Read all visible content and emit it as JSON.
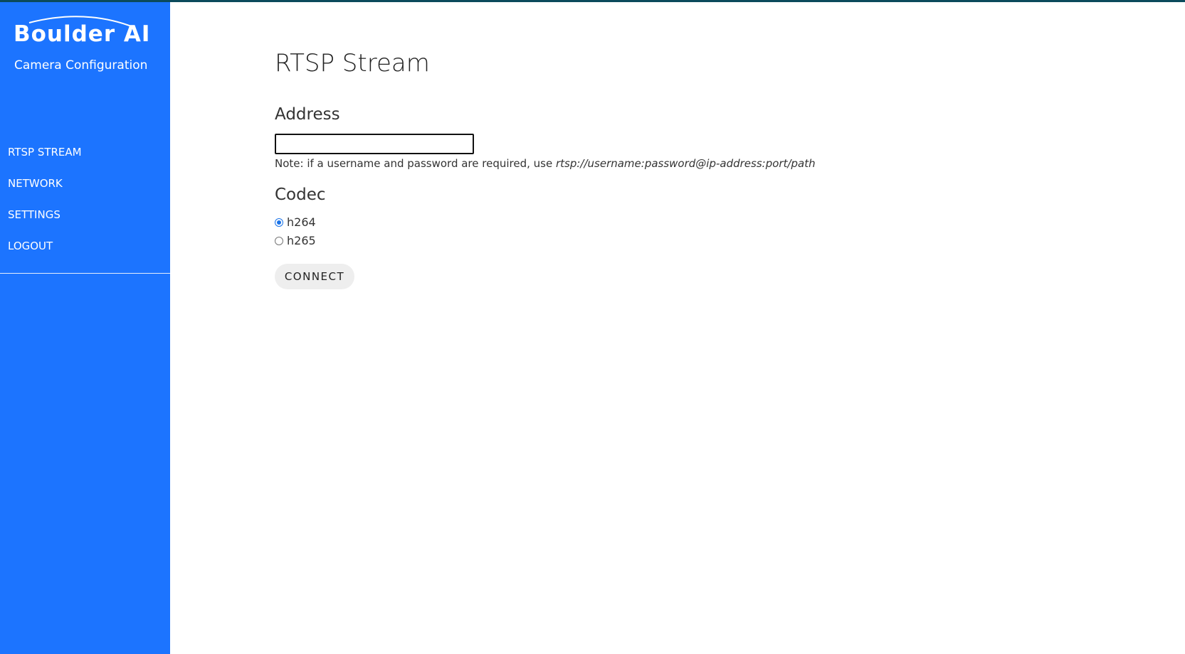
{
  "brand": {
    "logo_text": "Boulder AI",
    "subtitle": "Camera Configuration"
  },
  "nav": {
    "items": [
      {
        "label": "RTSP STREAM"
      },
      {
        "label": "NETWORK"
      },
      {
        "label": "SETTINGS"
      },
      {
        "label": "LOGOUT"
      }
    ]
  },
  "page": {
    "title": "RTSP Stream"
  },
  "address": {
    "label": "Address",
    "value": "",
    "placeholder": "",
    "note_prefix": "Note: if a username and password are required, use ",
    "note_example": "rtsp://username:password@ip-address:port/path"
  },
  "codec": {
    "label": "Codec",
    "options": [
      {
        "label": "h264",
        "selected": true
      },
      {
        "label": "h265",
        "selected": false
      }
    ]
  },
  "actions": {
    "connect_label": "CONNECT"
  },
  "colors": {
    "sidebar": "#1c74ff",
    "top_border": "#0b4a5c",
    "radio_accent": "#1a73e8",
    "button_bg": "#eeeeee"
  }
}
